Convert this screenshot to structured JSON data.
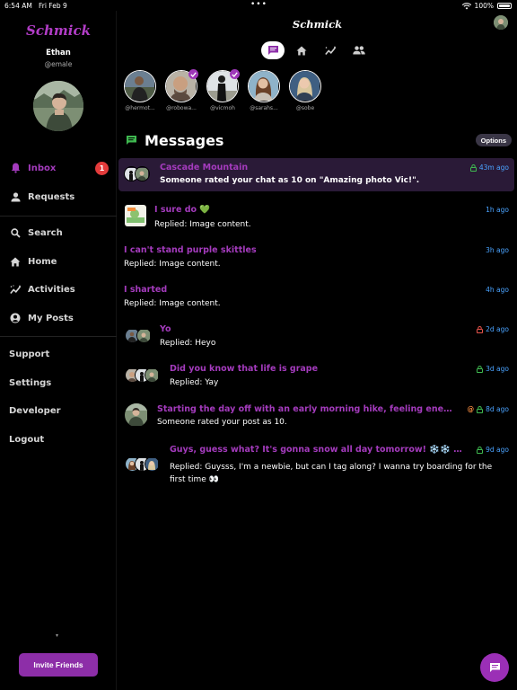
{
  "status_bar": {
    "time": "6:54 AM",
    "date": "Fri Feb 9",
    "battery": "100%",
    "dots": "•••"
  },
  "sidebar": {
    "logo": "Schmick",
    "user_name": "Ethan",
    "user_handle": "@emale",
    "nav": [
      {
        "label": "Inbox",
        "icon": "bell-icon",
        "badge": "1",
        "active": true
      },
      {
        "label": "Requests",
        "icon": "person-icon"
      },
      {
        "label": "Search",
        "icon": "search-icon"
      },
      {
        "label": "Home",
        "icon": "home-icon"
      },
      {
        "label": "Activities",
        "icon": "activity-icon"
      },
      {
        "label": "My Posts",
        "icon": "account-circle-icon"
      }
    ],
    "links": [
      "Support",
      "Settings",
      "Developer",
      "Logout"
    ],
    "caret": "▾",
    "invite_label": "Invite Friends"
  },
  "header": {
    "title": "Schmick"
  },
  "tabs": [
    "chat-icon",
    "home-icon",
    "activity-icon",
    "people-icon"
  ],
  "stories": [
    {
      "handle": "@hermot...",
      "verified": false
    },
    {
      "handle": "@robowa...",
      "verified": true
    },
    {
      "handle": "@vicmoh",
      "verified": true
    },
    {
      "handle": "@sarahs...",
      "verified": false
    },
    {
      "handle": "@sobe",
      "verified": false
    }
  ],
  "messages_title": "Messages",
  "options_label": "Options",
  "messages": [
    {
      "subject": "Cascade Mountain",
      "body": "Someone rated your chat as 10 on \"Amazing photo Vic!\".",
      "time": "43m ago",
      "lock": "green",
      "highlight": true
    },
    {
      "subject": "I sure do 💚",
      "body": "Replied: Image content.",
      "time": "1h ago"
    },
    {
      "subject": "I can't stand purple skittles",
      "body": "Replied: Image content.",
      "time": "3h ago"
    },
    {
      "subject": "I sharted",
      "body": "Replied: Image content.",
      "time": "4h ago"
    },
    {
      "subject": "Yo",
      "body": "Replied: Heyo",
      "time": "2d ago",
      "lock": "red"
    },
    {
      "subject": "Did you know that life is grape",
      "body": "Replied: Yay",
      "time": "3d ago",
      "lock": "green"
    },
    {
      "subject": "Starting the day off with an early morning hike, feeling energetic #Hi...",
      "body": "Someone rated your post as 10.",
      "time": "8d ago",
      "lock": "green",
      "at": "@"
    },
    {
      "subject": "Guys, guess what? It's gonna snow all day tomorrow! ❄️❄️ Total sno...",
      "body": "Replied: Guysss, I'm a newbie, but can I tag along? I wanna try boarding for the first time 👀",
      "time": "9d ago",
      "lock": "green"
    }
  ],
  "colors": {
    "accent": "#a43bbd",
    "highlight_bg": "#2a1a37",
    "time_blue": "#4aa3ff",
    "badge_red": "#e33b3b",
    "lock_green": "#3fb950",
    "lock_red": "#e5534b",
    "at_orange": "#f0883e"
  }
}
